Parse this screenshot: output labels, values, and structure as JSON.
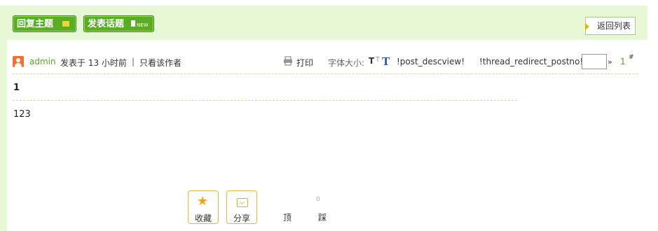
{
  "toolbar": {
    "reply_label": "回复主题",
    "new_topic_label": "发表话题",
    "new_tag": "NEW",
    "back_label": "返回列表"
  },
  "post": {
    "author": "admin",
    "posted_time": "发表于 13 小时前",
    "separator": "|",
    "only_author": "只看该作者",
    "print_label": "打印",
    "font_size_label": "字体大小:",
    "font_t": "T",
    "font_t_small": "T",
    "tt_icon": "T",
    "desc_view": "!post_descview!",
    "redirect_label": "!thread_redirect_postno!",
    "page_input_value": "",
    "raquo": "»",
    "floor": "1",
    "floor_mark": "#",
    "title": "1",
    "content": "123"
  },
  "actions": {
    "favorite_label": "收藏",
    "share_label": "分享",
    "up_label": "顶",
    "down_label": "踩",
    "down_count": "0"
  },
  "colors": {
    "panel_bg": "#e8f8d6",
    "button_green": "#5aad23",
    "author_green": "#59a02a",
    "action_border": "#e9b638",
    "avatar_orange": "#ef7432"
  }
}
